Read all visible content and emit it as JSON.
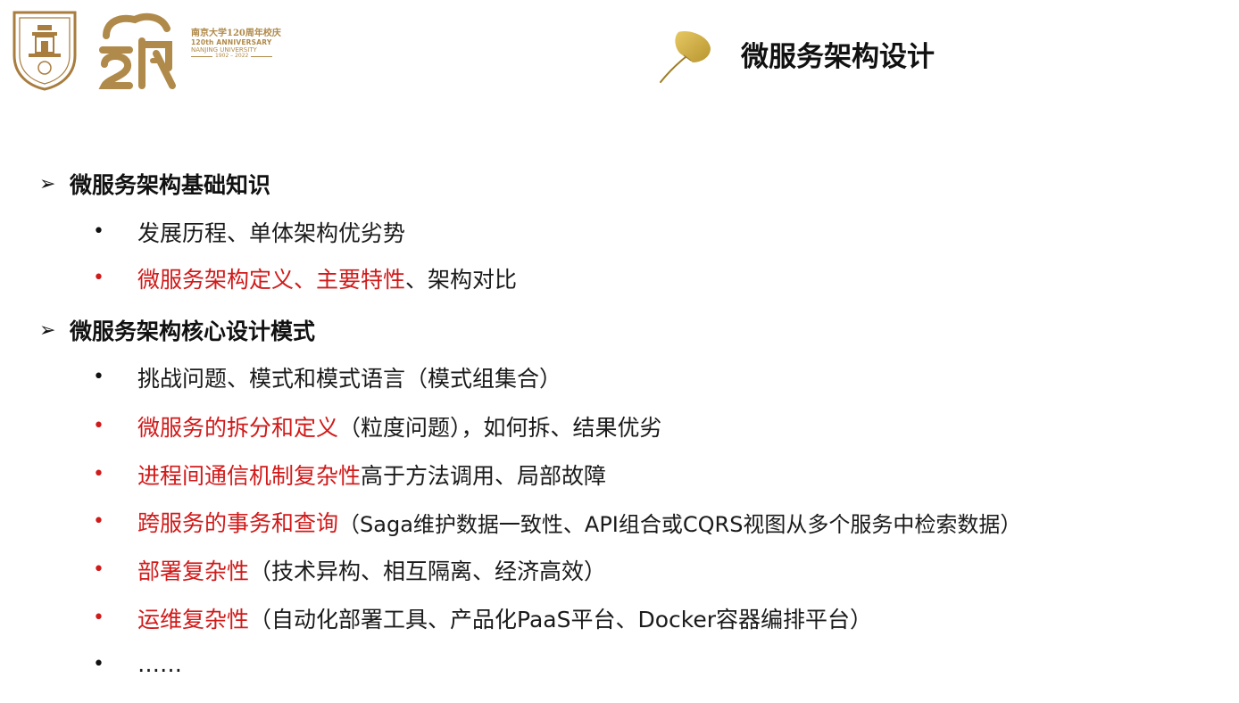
{
  "header": {
    "anniversary_cn": "南京大学120周年校庆",
    "anniversary_en": "120th ANNIVERSARY",
    "university": "NANJING UNIVERSITY",
    "years": "1902 – 2022",
    "seal_text": "NANJING UNIVERSITY",
    "title": "微服务架构设计"
  },
  "sections": [
    {
      "heading": "微服务架构基础知识",
      "bullets": [
        {
          "red": "",
          "black": "发展历程、单体架构优劣势"
        },
        {
          "red": "微服务架构定义、主要特性",
          "black": "、架构对比"
        }
      ]
    },
    {
      "heading": "微服务架构核心设计模式",
      "bullets": [
        {
          "red": "",
          "black": "挑战问题、模式和模式语言（模式组集合）"
        },
        {
          "red": "微服务的拆分和定义",
          "black": "（粒度问题），如何拆、结果优劣"
        },
        {
          "red": "进程间通信机制复杂性",
          "black": "高于方法调用、局部故障"
        },
        {
          "red": "跨服务的事务和查询",
          "black": "（Saga维护数据一致性、API组合或CQRS视图从多个服务中检索数据）"
        },
        {
          "red": "部署复杂性",
          "black": "（技术异构、相互隔离、经济高效）"
        },
        {
          "red": "运维复杂性",
          "black": "（自动化部署工具、产品化PaaS平台、Docker容器编排平台）"
        },
        {
          "red": "",
          "black": "……"
        }
      ]
    }
  ],
  "colors": {
    "accent_red": "#d11a1a",
    "gold": "#b08a4a",
    "text": "#1a1a1a"
  },
  "icons": {
    "arrow": "triangle-arrow-icon",
    "bullet": "bullet-dot-icon",
    "leaf": "ginkgo-leaf-icon"
  }
}
